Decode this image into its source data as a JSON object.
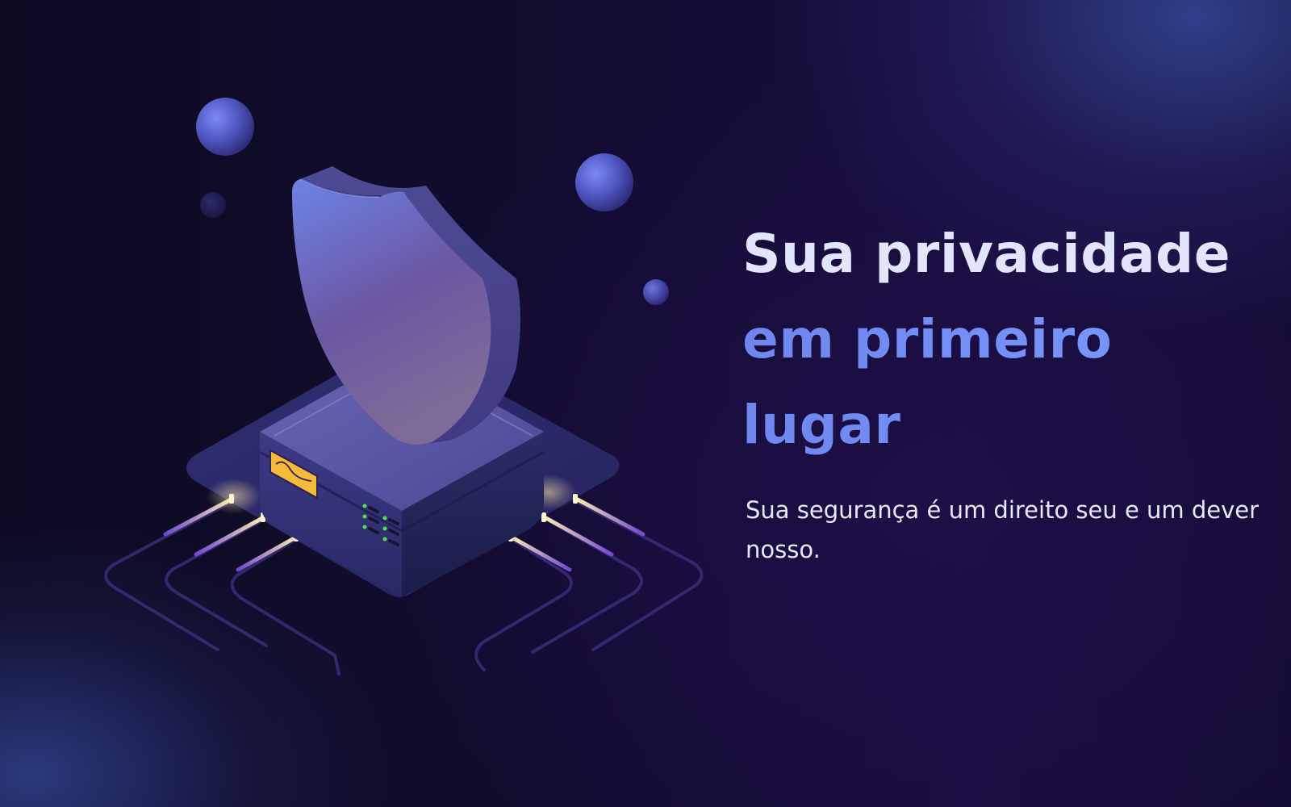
{
  "hero": {
    "title_line_1": "Sua privacidade",
    "title_line_2": "em primeiro lugar",
    "subtitle": "Sua segurança é um direito seu e um dever nosso."
  },
  "illustration": {
    "icon": "shield-server-icon"
  },
  "colors": {
    "background": "#120c30",
    "title_primary": "#e1e5ff",
    "title_accent": "#6f8cf2",
    "text": "#e8e9fa",
    "shield": "#6a5aa8",
    "glow": "#fff1b0",
    "led": "#4ee34a"
  }
}
